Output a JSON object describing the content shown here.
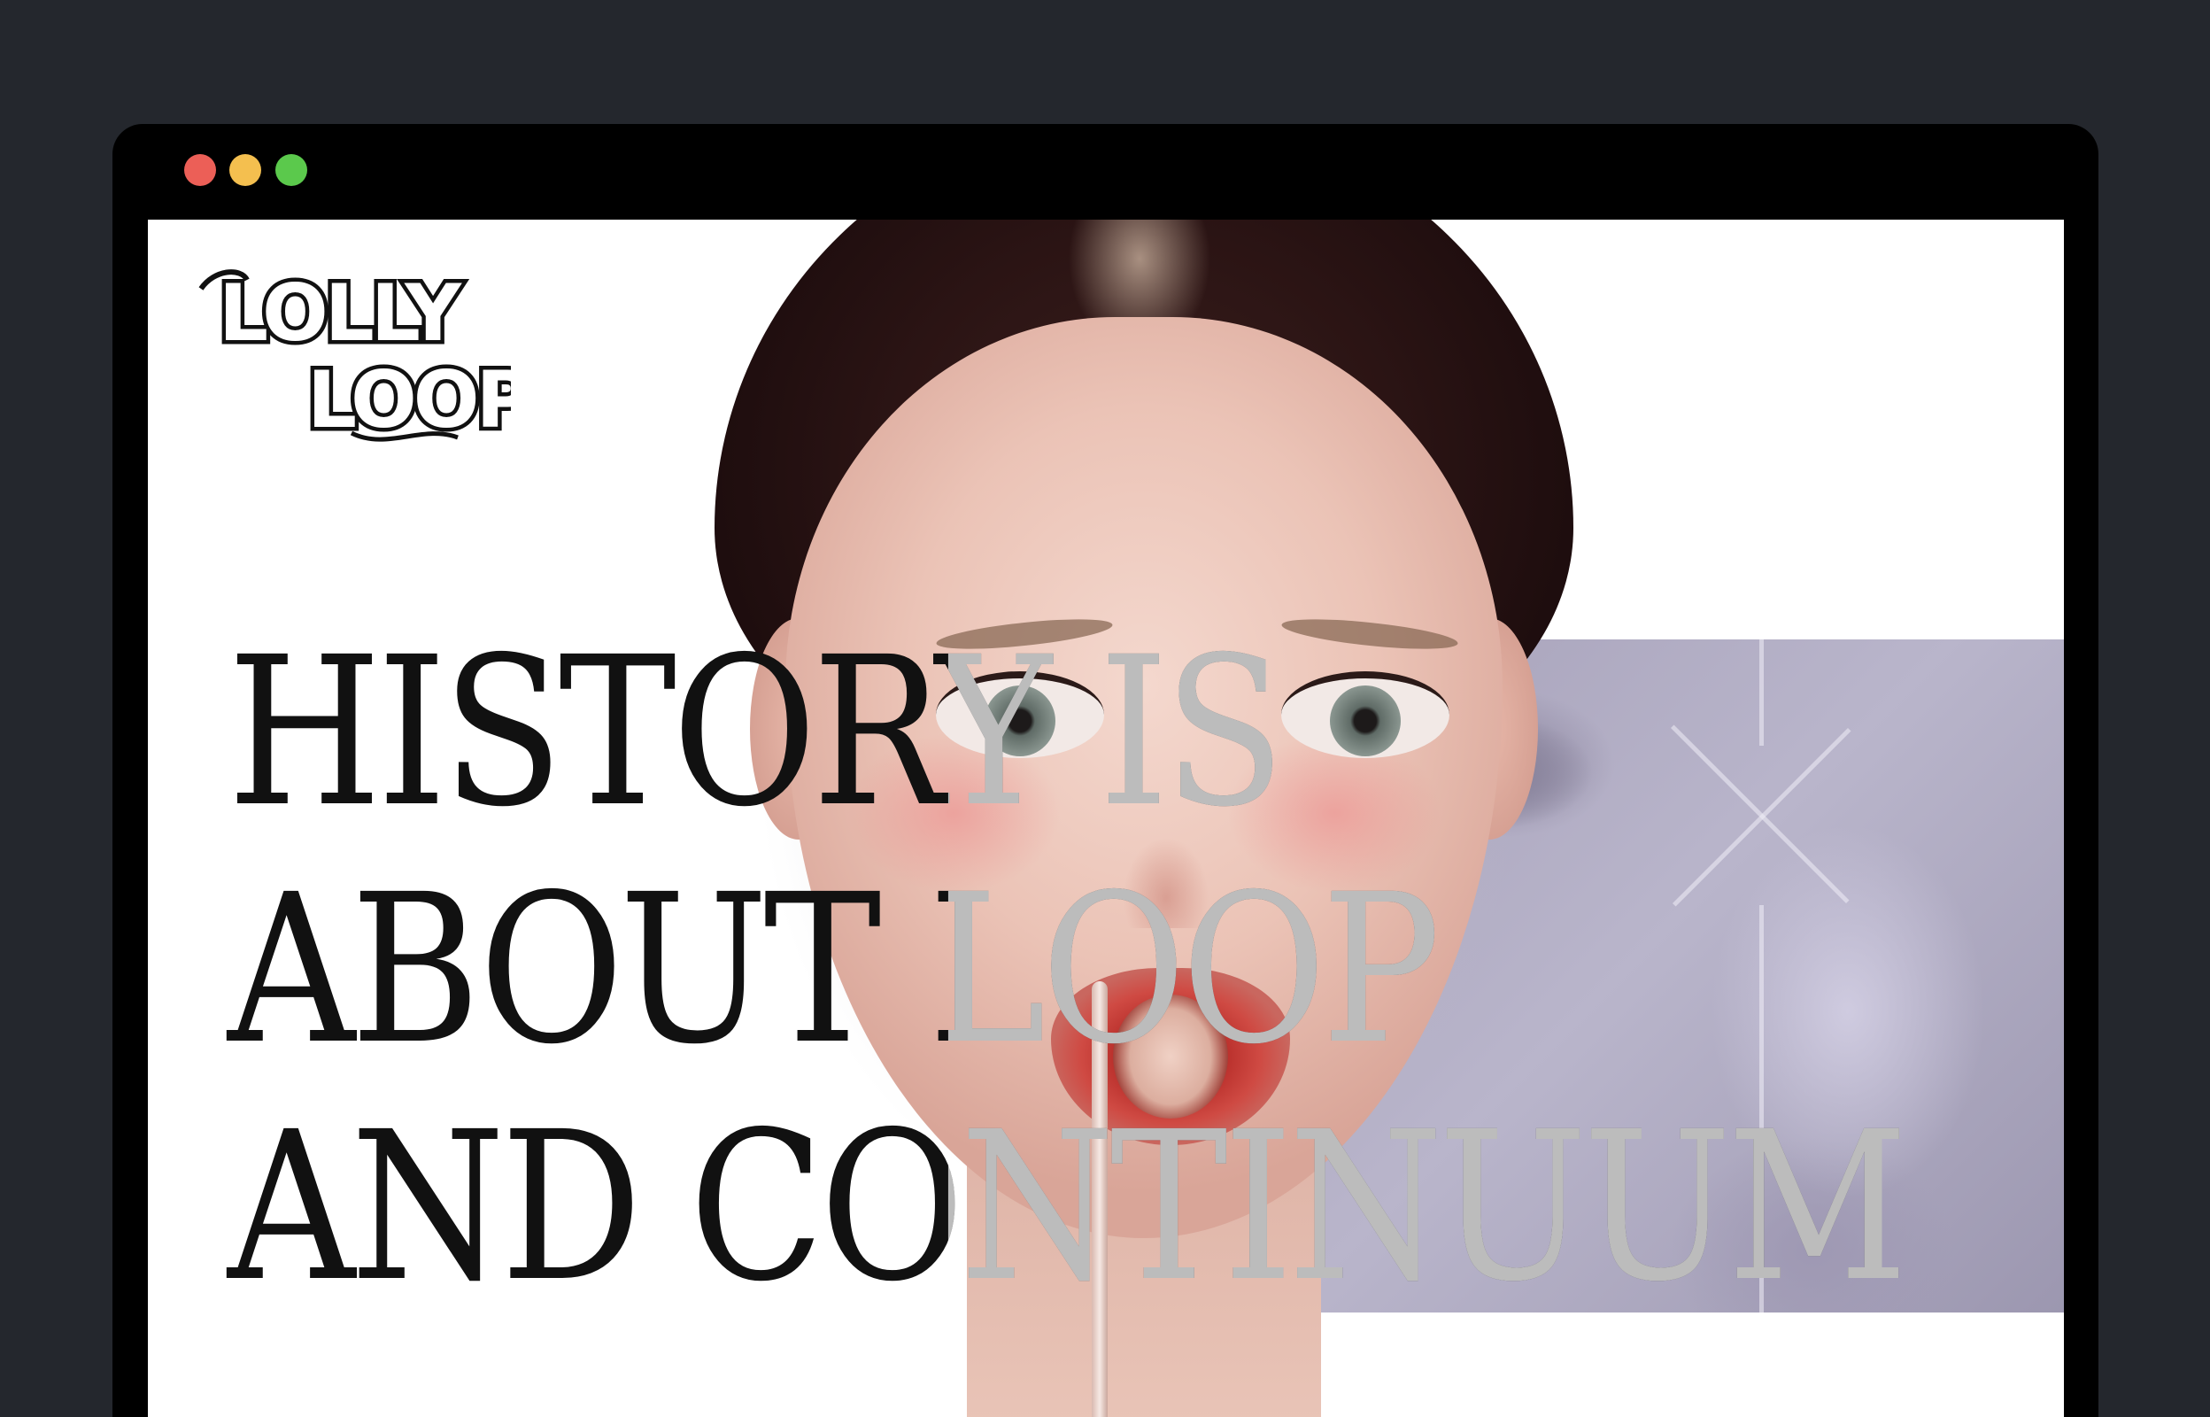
{
  "window": {
    "controls": [
      "close",
      "minimize",
      "maximize"
    ],
    "colors": {
      "close": "#ec5f57",
      "minimize": "#f4bf4f",
      "maximize": "#5bc94c"
    }
  },
  "logo": {
    "line1": "LOLLY",
    "line2": "LOOP"
  },
  "hero": {
    "headline_lines": [
      "HISTORY IS",
      "ABOUT LOOP",
      "AND CONTINUUM"
    ],
    "image_alt": "portrait-illustration-with-lollipop"
  },
  "colors": {
    "page_background": "#24272d",
    "browser_frame": "#000000",
    "viewport": "#ffffff",
    "headline_text": "#111111",
    "statue_panel": "#a7a2ba"
  }
}
